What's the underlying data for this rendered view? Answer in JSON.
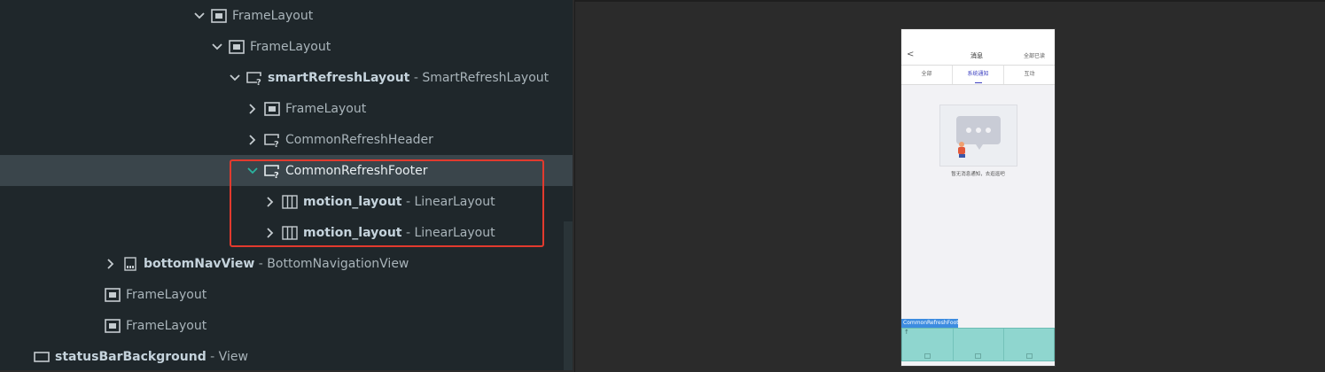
{
  "tree": {
    "rows": [
      {
        "name": "",
        "type": "FrameLayout",
        "expanded": true,
        "icon": "frame-layout-icon"
      },
      {
        "name": "",
        "type": "FrameLayout",
        "expanded": true,
        "icon": "frame-layout-icon"
      },
      {
        "name": "smartRefreshLayout",
        "separator": " - ",
        "type": "SmartRefreshLayout",
        "expanded": true,
        "icon": "unknown-view-icon"
      },
      {
        "name": "",
        "type": "FrameLayout",
        "expanded": false,
        "icon": "frame-layout-icon"
      },
      {
        "name": "",
        "type": "CommonRefreshHeader",
        "expanded": false,
        "icon": "unknown-view-icon"
      },
      {
        "name": "",
        "type": "CommonRefreshFooter",
        "expanded": true,
        "icon": "unknown-view-icon",
        "selected": true
      },
      {
        "name": "motion_layout",
        "separator": " - ",
        "type": "LinearLayout",
        "expanded": false,
        "icon": "linear-layout-icon"
      },
      {
        "name": "motion_layout",
        "separator": " - ",
        "type": "LinearLayout",
        "expanded": false,
        "icon": "linear-layout-icon"
      },
      {
        "name": "bottomNavView",
        "separator": " - ",
        "type": "BottomNavigationView",
        "expanded": false,
        "icon": "bottom-nav-icon"
      },
      {
        "name": "",
        "type": "FrameLayout",
        "expanded": null,
        "icon": "frame-layout-icon"
      },
      {
        "name": "",
        "type": "FrameLayout",
        "expanded": null,
        "icon": "frame-layout-icon"
      },
      {
        "name": "statusBarBackground",
        "separator": " - ",
        "type": "View",
        "expanded": null,
        "icon": "view-icon"
      }
    ]
  },
  "preview": {
    "navbar": {
      "back": "<",
      "title": "消息",
      "right": "全部已读"
    },
    "tabs": [
      {
        "label": "全部",
        "active": false
      },
      {
        "label": "系统通知",
        "active": true
      },
      {
        "label": "互动",
        "active": false
      }
    ],
    "empty_text": "暂无消息通知，去逛逛吧",
    "footer_label": "CommonRefreshFooter"
  },
  "colors": {
    "selection_highlight": "#e23a2e",
    "footer_overlay": "#8fd6cf",
    "label_badge": "#3d8ce0",
    "active_tab": "#3b3fc0"
  }
}
